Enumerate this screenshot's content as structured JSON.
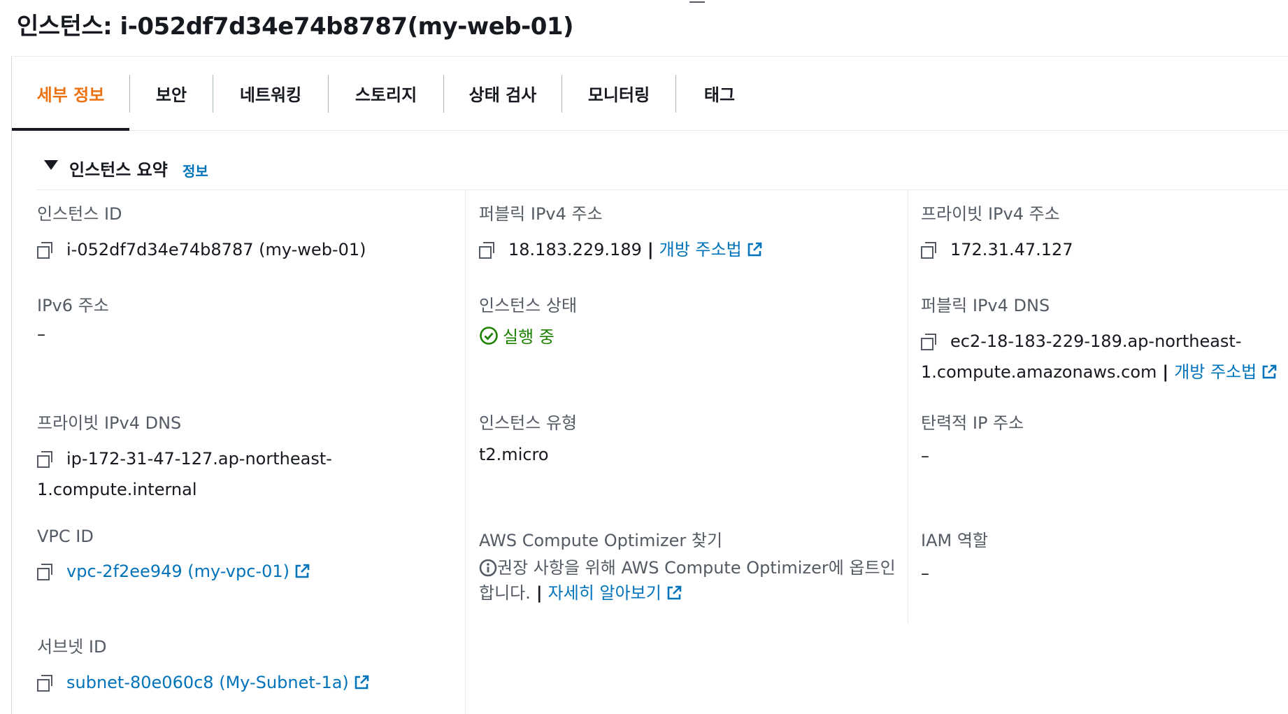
{
  "header": {
    "title": "인스턴스: i-052df7d34e74b8787(my-web-01)"
  },
  "tabs": [
    {
      "label": "세부 정보",
      "active": true
    },
    {
      "label": "보안",
      "active": false
    },
    {
      "label": "네트워킹",
      "active": false
    },
    {
      "label": "스토리지",
      "active": false
    },
    {
      "label": "상태 검사",
      "active": false
    },
    {
      "label": "모니터링",
      "active": false
    },
    {
      "label": "태그",
      "active": false
    }
  ],
  "summary": {
    "title": "인스턴스 요약",
    "info_link": "정보",
    "instance_id": {
      "label": "인스턴스 ID",
      "value": "i-052df7d34e74b8787 (my-web-01)"
    },
    "public_ipv4": {
      "label": "퍼블릭 IPv4 주소",
      "value": "18.183.229.189",
      "link": "개방 주소법"
    },
    "private_ipv4": {
      "label": "프라이빗 IPv4 주소",
      "value": "172.31.47.127"
    },
    "ipv6": {
      "label": "IPv6 주소",
      "value": "–"
    },
    "instance_state": {
      "label": "인스턴스 상태",
      "value": "실행 중"
    },
    "public_dns": {
      "label": "퍼블릭 IPv4 DNS",
      "value_line1": "ec2-18-183-229-189.ap-northeast-",
      "value_line2": "1.compute.amazonaws.com",
      "link": "개방 주소법"
    },
    "private_dns": {
      "label": "프라이빗 IPv4 DNS",
      "value_line1": "ip-172-31-47-127.ap-northeast-",
      "value_line2": "1.compute.internal"
    },
    "instance_type": {
      "label": "인스턴스 유형",
      "value": "t2.micro"
    },
    "elastic_ip": {
      "label": "탄력적 IP 주소",
      "value": "–"
    },
    "vpc_id": {
      "label": "VPC ID",
      "value": "vpc-2f2ee949 (my-vpc-01)"
    },
    "optimizer": {
      "label": "AWS Compute Optimizer 찾기",
      "line1": "권장 사항을 위해 AWS Compute Optimizer에 옵트인",
      "line2": "합니다.",
      "link": "자세히 알아보기"
    },
    "iam_role": {
      "label": "IAM 역할",
      "value": "–"
    },
    "subnet_id": {
      "label": "서브넷 ID",
      "value": "subnet-80e060c8 (My-Subnet-1a)"
    }
  },
  "colors": {
    "accent_active_tab": "#ec7211",
    "link": "#0073bb",
    "success": "#1d8102",
    "label": "#545b64"
  }
}
